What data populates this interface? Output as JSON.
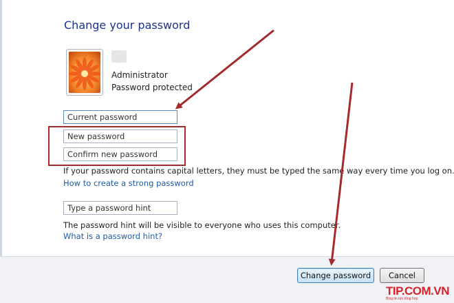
{
  "dialog": {
    "title": "Change your password"
  },
  "user": {
    "role": "Administrator",
    "status": "Password protected"
  },
  "form": {
    "current_password_placeholder": "Current password",
    "new_password_placeholder": "New password",
    "confirm_password_placeholder": "Confirm new password",
    "capital_letters_note": "If your password contains capital letters, they must be typed the same way every time you log on.",
    "strong_password_link": "How to create a strong password",
    "hint_placeholder": "Type a password hint",
    "hint_note": "The password hint will be visible to everyone who uses this computer.",
    "hint_link": "What is a password hint?"
  },
  "buttons": {
    "change_password": "Change password",
    "cancel": "Cancel"
  },
  "watermark": {
    "brand": "TIP.COM.VN",
    "tagline": "Blog tin tức tổng hợp"
  },
  "colors": {
    "title": "#1e3287",
    "link": "#1f5aa6",
    "annotation": "#a32b2b",
    "watermark": "#d8232a"
  }
}
